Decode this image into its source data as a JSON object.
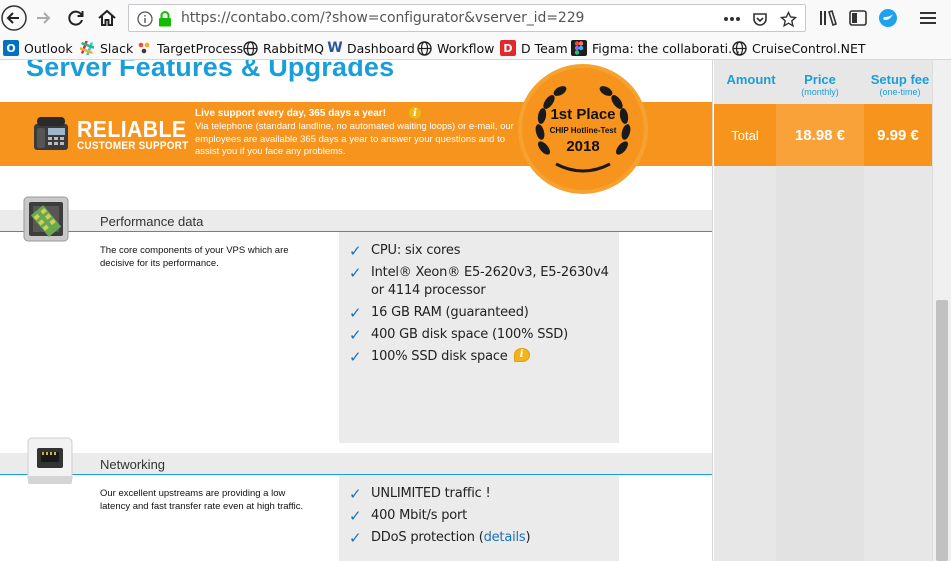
{
  "browser": {
    "url": "https://contabo.com/?show=configurator&vserver_id=229",
    "bookmarks": [
      {
        "label": "Outlook",
        "icon": "outlook-icon"
      },
      {
        "label": "Slack",
        "icon": "slack-icon"
      },
      {
        "label": "TargetProcess",
        "icon": "targetprocess-icon"
      },
      {
        "label": "RabbitMQ",
        "icon": "globe-icon"
      },
      {
        "label": "Dashboard",
        "icon": "w-icon"
      },
      {
        "label": "Workflow",
        "icon": "globe-icon"
      },
      {
        "label": "D Team",
        "icon": "d-icon"
      },
      {
        "label": "Figma: the collaborati...",
        "icon": "figma-icon"
      },
      {
        "label": "CruiseControl.NET",
        "icon": "globe-icon"
      }
    ]
  },
  "page": {
    "heading": "Server Features & Upgrades",
    "support": {
      "reliable": "RELIABLE",
      "customer_support": "CUSTOMER SUPPORT",
      "title": "Live support every day, 365 days a year!",
      "text": "Via telephone (standard landline, no automated waiting loops) or e-mail, our employees are available 365 days a year to answer your questions and to assist you if you face any problems."
    },
    "award": {
      "line1": "1st Place",
      "line2": "CHIP Hotline-Test",
      "line3": "2018"
    },
    "sections": [
      {
        "title": "Performance data",
        "description": "The core components of your VPS which are decisive for its performance.",
        "features": [
          "CPU: six cores",
          "Intel® Xeon® E5-2620v3, E5-2630v4 or 4114 processor",
          "16 GB RAM (guaranteed)",
          "400 GB disk space (100% SSD)",
          "100% SSD disk space"
        ]
      },
      {
        "title": "Networking",
        "description": "Our excellent upstreams are providing a low latency and fast transfer rate even at high traffic.",
        "features": [
          "UNLIMITED traffic !",
          "400 Mbit/s port",
          "DDoS protection ("
        ],
        "link_text": "details",
        "link_suffix": ")"
      }
    ]
  },
  "summary": {
    "amount_header": "Amount",
    "price_header": "Price",
    "price_sub": "(monthly)",
    "setup_header": "Setup fee",
    "setup_sub": "(one-time)",
    "total_label": "Total",
    "total_price": "18.98 €",
    "total_setup": "9.99 €"
  },
  "colors": {
    "accent_blue": "#1a9ed9",
    "orange": "#f7941d"
  }
}
